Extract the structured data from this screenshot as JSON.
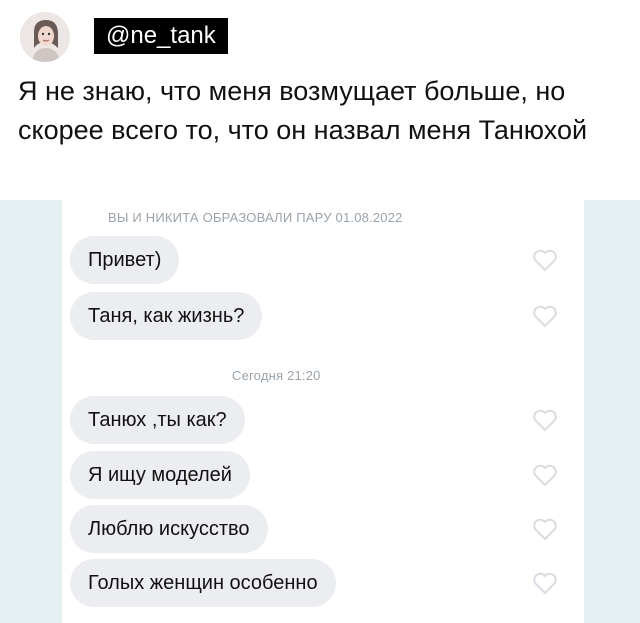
{
  "post": {
    "username": "@ne_tank",
    "text": "Я не знаю, что меня возмущает больше, но скорее всего то, что он назвал меня Танюхой"
  },
  "chat": {
    "pair_banner": "ВЫ И НИКИТА ОБРАЗОВАЛИ ПАРУ 01.08.2022",
    "today_banner": "Сегодня 21:20",
    "messages_before": [
      {
        "text": "Привет)"
      },
      {
        "text": "Таня, как жизнь?"
      }
    ],
    "messages_today": [
      {
        "text": "Танюх ,ты как?"
      },
      {
        "text": "Я ищу моделей"
      },
      {
        "text": "Люблю искусство"
      },
      {
        "text": "Голых женщин особенно"
      }
    ],
    "icons": {
      "like": "heart-outline-icon",
      "avatar": "profile-photo"
    },
    "colors": {
      "bubble": "#ebedf0",
      "frame": "#e3eff0",
      "heart": "#d9dde2",
      "banner": "#9aa3ab"
    }
  }
}
